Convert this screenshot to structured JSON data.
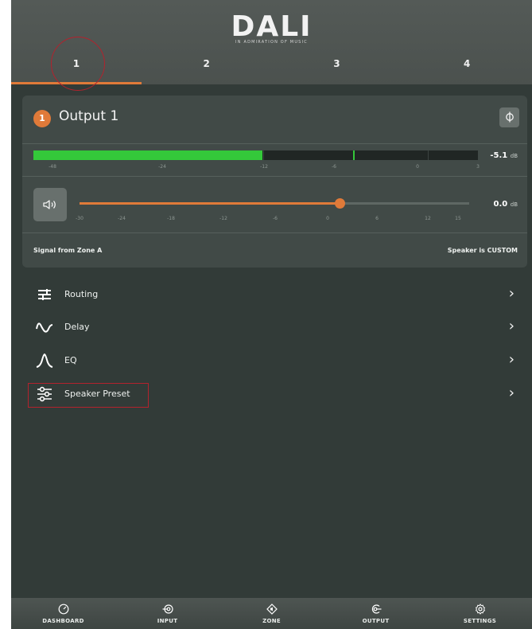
{
  "header": {
    "logo": "DALI",
    "tagline": "IN ADMIRATION OF MUSIC",
    "tabs": [
      {
        "label": "1",
        "active": true
      },
      {
        "label": "2",
        "active": false
      },
      {
        "label": "3",
        "active": false
      },
      {
        "label": "4",
        "active": false
      }
    ]
  },
  "output": {
    "badge": "1",
    "title": "Output 1",
    "phase_icon": "phase-icon",
    "meter": {
      "value_text": "-5.1",
      "unit": "dB",
      "level_fraction": 0.516,
      "peak_fraction": 0.72,
      "scale": [
        "-48",
        "-24",
        "-12",
        "-6",
        "0",
        "3"
      ]
    },
    "volume": {
      "mute_icon": "speaker-icon",
      "value_text": "0.0",
      "unit": "dB",
      "level_fraction": 0.667,
      "scale": [
        "-30",
        "-24",
        "-18",
        "-12",
        "-6",
        "0",
        "6",
        "12",
        "15"
      ]
    },
    "signal_text": "Signal from Zone A",
    "speaker_text": "Speaker is CUSTOM"
  },
  "menu": [
    {
      "label": "Routing",
      "icon": "routing-icon"
    },
    {
      "label": "Delay",
      "icon": "delay-wave-icon"
    },
    {
      "label": "EQ",
      "icon": "eq-curve-icon"
    },
    {
      "label": "Speaker Preset",
      "icon": "sliders-icon"
    }
  ],
  "bottom_nav": [
    {
      "label": "DASHBOARD",
      "icon": "gauge-icon"
    },
    {
      "label": "INPUT",
      "icon": "input-icon"
    },
    {
      "label": "ZONE",
      "icon": "zone-icon"
    },
    {
      "label": "OUTPUT",
      "icon": "output-icon"
    },
    {
      "label": "SETTINGS",
      "icon": "gear-icon"
    }
  ],
  "colors": {
    "accent": "#e07a39",
    "meter_green": "#34c83a",
    "background": "#323b38",
    "card": "#414a47",
    "annotation_red": "#b3222d"
  }
}
